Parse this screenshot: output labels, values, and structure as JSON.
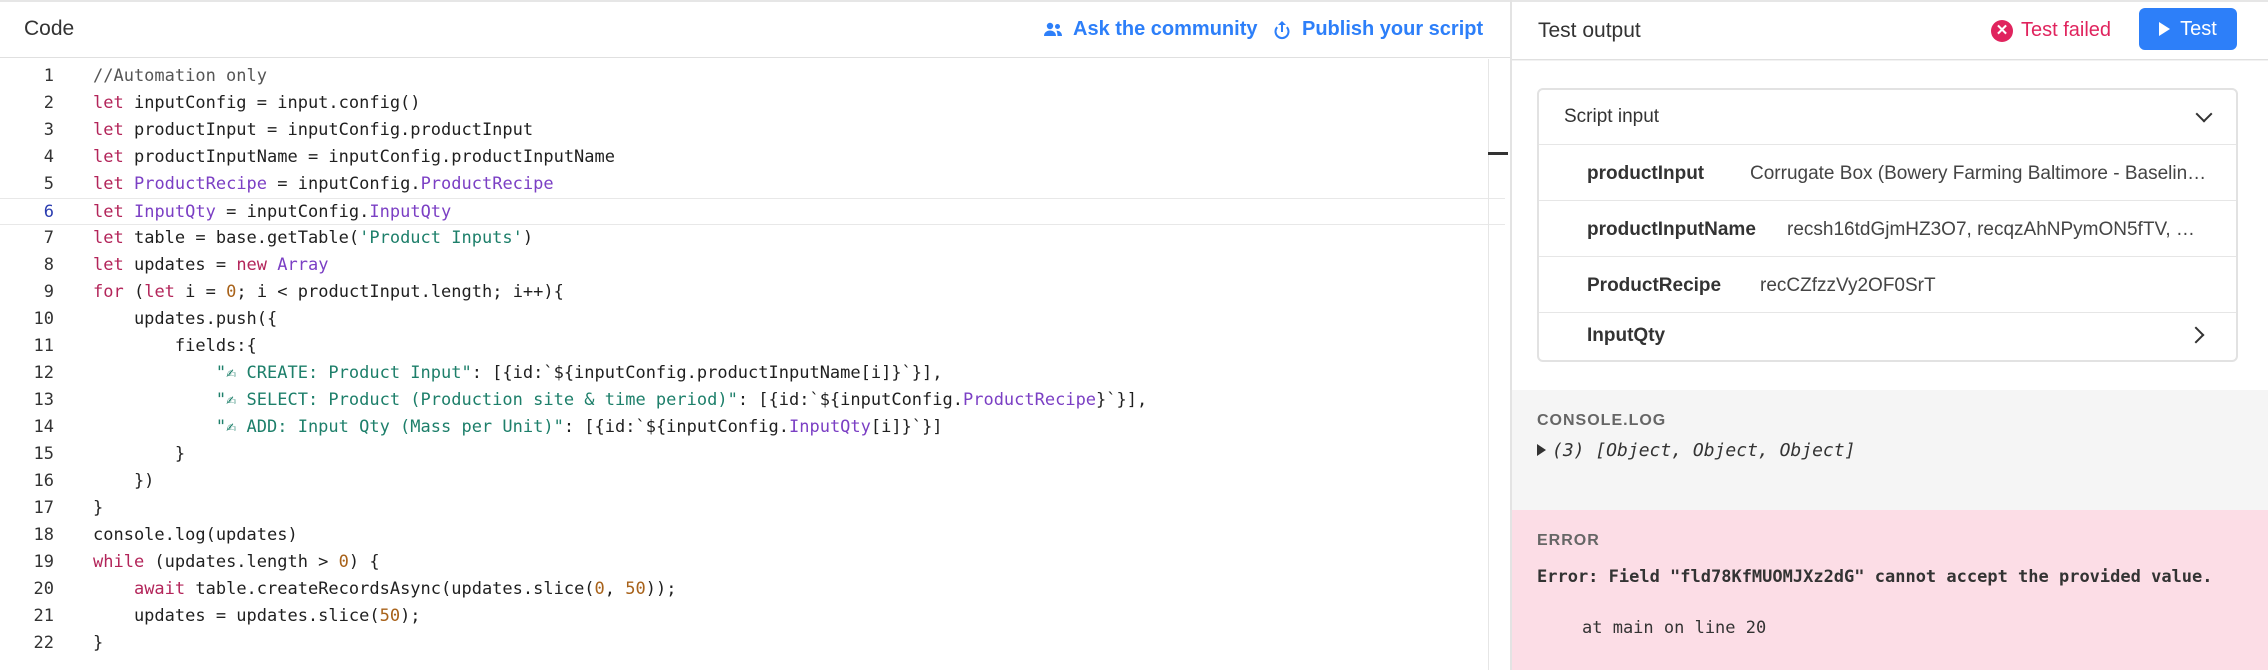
{
  "code_pane": {
    "title": "Code",
    "ask_community": "Ask the community",
    "publish_script": "Publish your script"
  },
  "editor": {
    "active_line": 6,
    "lines": [
      [
        {
          "t": "//Automation only",
          "c": "cmt"
        }
      ],
      [
        {
          "t": "let",
          "c": "kw"
        },
        {
          "t": " inputConfig = input.config()"
        }
      ],
      [
        {
          "t": "let",
          "c": "kw"
        },
        {
          "t": " productInput = inputConfig.productInput"
        }
      ],
      [
        {
          "t": "let",
          "c": "kw"
        },
        {
          "t": " productInputName = inputConfig.productInputName"
        }
      ],
      [
        {
          "t": "let",
          "c": "kw"
        },
        {
          "t": " "
        },
        {
          "t": "ProductRecipe",
          "c": "vp"
        },
        {
          "t": " = inputConfig."
        },
        {
          "t": "ProductRecipe",
          "c": "vp"
        }
      ],
      [
        {
          "t": "let",
          "c": "kw"
        },
        {
          "t": " "
        },
        {
          "t": "InputQty",
          "c": "vp"
        },
        {
          "t": " = inputConfig."
        },
        {
          "t": "InputQty",
          "c": "vp"
        }
      ],
      [
        {
          "t": "let",
          "c": "kw"
        },
        {
          "t": " table = base.getTable("
        },
        {
          "t": "'Product Inputs'",
          "c": "str"
        },
        {
          "t": ")"
        }
      ],
      [
        {
          "t": "let",
          "c": "kw"
        },
        {
          "t": " updates = "
        },
        {
          "t": "new",
          "c": "kw"
        },
        {
          "t": " "
        },
        {
          "t": "Array",
          "c": "vp"
        }
      ],
      [
        {
          "t": "for",
          "c": "kw"
        },
        {
          "t": " ("
        },
        {
          "t": "let",
          "c": "kw"
        },
        {
          "t": " i = "
        },
        {
          "t": "0",
          "c": "num"
        },
        {
          "t": "; i < productInput.length; i++){"
        }
      ],
      [
        {
          "t": "    updates.push({"
        }
      ],
      [
        {
          "t": "        fields:{"
        }
      ],
      [
        {
          "t": "            "
        },
        {
          "t": "\"✍ CREATE: Product Input\"",
          "c": "str"
        },
        {
          "t": ": [{id:`${inputConfig.productInputName[i]}`}],"
        }
      ],
      [
        {
          "t": "            "
        },
        {
          "t": "\"✍ SELECT: Product (Production site & time period)\"",
          "c": "str"
        },
        {
          "t": ": [{id:`${inputConfig."
        },
        {
          "t": "ProductRecipe",
          "c": "vp"
        },
        {
          "t": "}`}],"
        }
      ],
      [
        {
          "t": "            "
        },
        {
          "t": "\"✍ ADD: Input Qty (Mass per Unit)\"",
          "c": "str"
        },
        {
          "t": ": [{id:`${inputConfig."
        },
        {
          "t": "InputQty",
          "c": "vp"
        },
        {
          "t": "[i]}`}]"
        }
      ],
      [
        {
          "t": "        }"
        }
      ],
      [
        {
          "t": "    })"
        }
      ],
      [
        {
          "t": "}"
        }
      ],
      [
        {
          "t": "console.log(updates)"
        }
      ],
      [
        {
          "t": "while",
          "c": "kw"
        },
        {
          "t": " (updates.length > "
        },
        {
          "t": "0",
          "c": "num"
        },
        {
          "t": ") {"
        }
      ],
      [
        {
          "t": "    "
        },
        {
          "t": "await",
          "c": "kw"
        },
        {
          "t": " table.createRecordsAsync(updates.slice("
        },
        {
          "t": "0",
          "c": "num"
        },
        {
          "t": ", "
        },
        {
          "t": "50",
          "c": "num"
        },
        {
          "t": "));"
        }
      ],
      [
        {
          "t": "    updates = updates.slice("
        },
        {
          "t": "50",
          "c": "num"
        },
        {
          "t": ");"
        }
      ],
      [
        {
          "t": "}"
        }
      ]
    ]
  },
  "output_pane": {
    "title": "Test output",
    "status": "Test failed",
    "test_button": "Test"
  },
  "script_input": {
    "title": "Script input",
    "rows": [
      {
        "key": "productInput",
        "value": "Corrugate Box (Bowery Farming Baltimore - Baselin…"
      },
      {
        "key": "productInputName",
        "value": "recsh16tdGjmHZ3O7, recqzAhNPymON5fTV, …"
      },
      {
        "key": "ProductRecipe",
        "value": "recCZfzzVy2OF0SrT"
      },
      {
        "key": "InputQty",
        "value": ""
      }
    ]
  },
  "console": {
    "label": "CONSOLE.LOG",
    "output": "(3) [Object, Object, Object]"
  },
  "error": {
    "label": "ERROR",
    "message": "Error: Field \"fld78KfMUOMJXz2dG\" cannot accept the provided value.",
    "location": "at main on line 20"
  }
}
